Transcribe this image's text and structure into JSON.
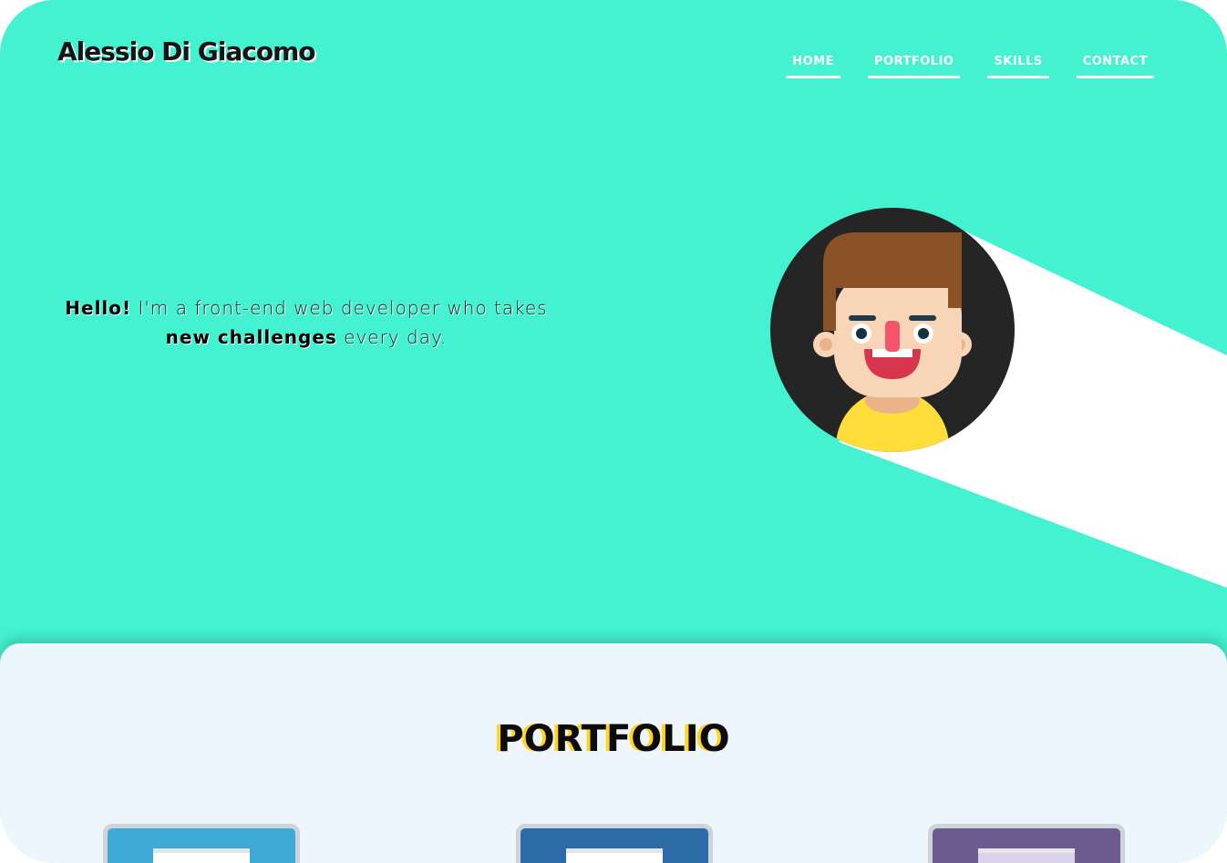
{
  "header": {
    "logo": "Alessio Di Giacomo",
    "nav": [
      {
        "label": "HOME"
      },
      {
        "label": "PORTFOLIO"
      },
      {
        "label": "SKILLS"
      },
      {
        "label": "CONTACT"
      }
    ]
  },
  "hero": {
    "greeting": "Hello!",
    "text_1": " I'm a front-end web developer who takes ",
    "highlight": "new challenges",
    "text_2": " every day."
  },
  "portfolio": {
    "title": "PORTFOLIO",
    "projects": [
      {
        "color": "#3fa9d5"
      },
      {
        "color": "#2c6aa8"
      },
      {
        "color": "#6c5b8f"
      }
    ]
  },
  "colors": {
    "hero_bg": "#44f2d2",
    "portfolio_bg": "#eef6fd",
    "accent": "#ffd51f"
  }
}
